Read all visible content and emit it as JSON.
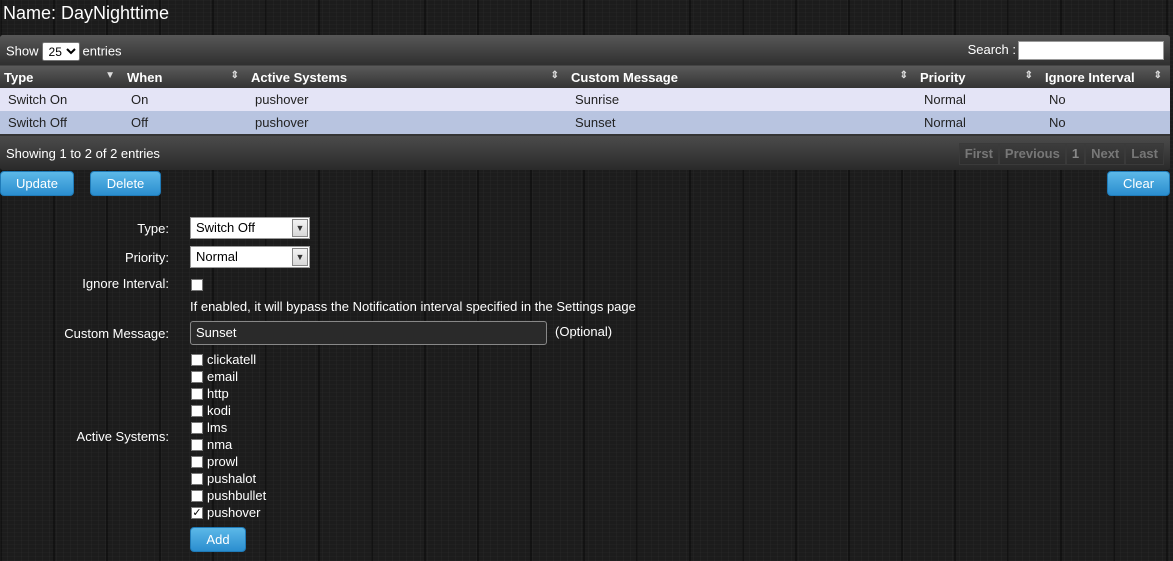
{
  "page": {
    "title": "Name: DayNighttime"
  },
  "table": {
    "show_label": "Show",
    "entries_value": "25",
    "entries_label": "entries",
    "search_label": "Search :",
    "search_value": "",
    "columns": [
      "Type",
      "When",
      "Active Systems",
      "Custom Message",
      "Priority",
      "Ignore Interval"
    ],
    "rows": [
      [
        "Switch On",
        "On",
        "pushover",
        "Sunrise",
        "Normal",
        "No"
      ],
      [
        "Switch Off",
        "Off",
        "pushover",
        "Sunset",
        "Normal",
        "No"
      ]
    ],
    "info": "Showing 1 to 2 of 2 entries",
    "pager": [
      "First",
      "Previous",
      "1",
      "Next",
      "Last"
    ]
  },
  "buttons": {
    "update": "Update",
    "delete": "Delete",
    "clear": "Clear",
    "add": "Add"
  },
  "form": {
    "type_label": "Type:",
    "type_value": "Switch Off",
    "priority_label": "Priority:",
    "priority_value": "Normal",
    "ignore_label": "Ignore Interval:",
    "ignore_checked": false,
    "ignore_help": "If enabled, it will bypass the Notification interval specified in the Settings page",
    "message_label": "Custom Message:",
    "message_value": "Sunset",
    "message_optional": "(Optional)",
    "systems_label": "Active Systems:",
    "systems": [
      {
        "label": "clickatell",
        "checked": false
      },
      {
        "label": "email",
        "checked": false
      },
      {
        "label": "http",
        "checked": false
      },
      {
        "label": "kodi",
        "checked": false
      },
      {
        "label": "lms",
        "checked": false
      },
      {
        "label": "nma",
        "checked": false
      },
      {
        "label": "prowl",
        "checked": false
      },
      {
        "label": "pushalot",
        "checked": false
      },
      {
        "label": "pushbullet",
        "checked": false
      },
      {
        "label": "pushover",
        "checked": true
      }
    ]
  },
  "colors": {
    "button": "#2b8ecf",
    "row_odd": "#e4e4f6",
    "row_even": "#b8c4e0"
  }
}
